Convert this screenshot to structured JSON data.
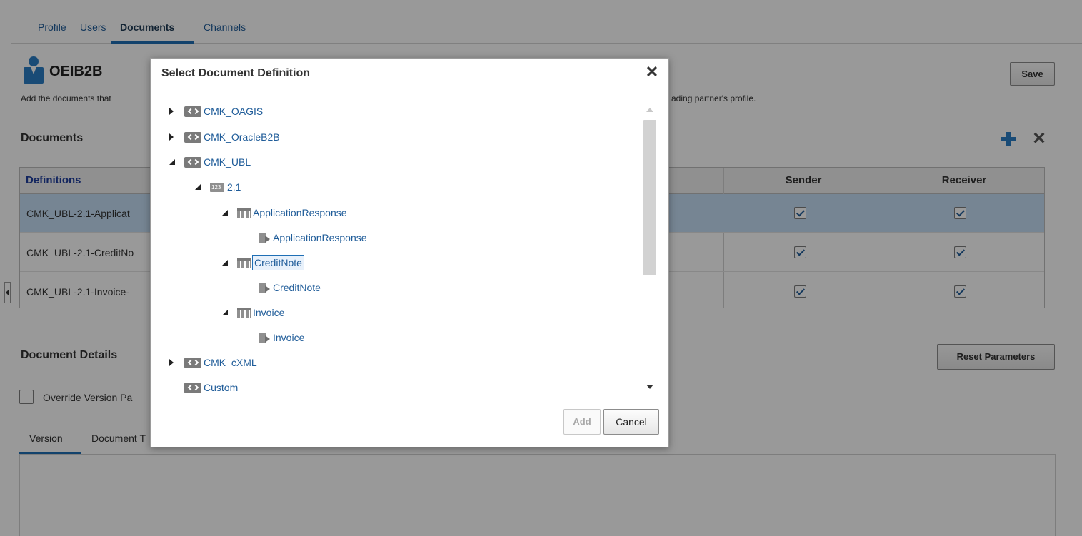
{
  "tabs": [
    {
      "label": "Profile"
    },
    {
      "label": "Users"
    },
    {
      "label": "Documents"
    },
    {
      "label": "Channels"
    }
  ],
  "active_tab": "Documents",
  "partner": {
    "name": "OEIB2B",
    "description_left": "Add the documents that",
    "description_right": "ading partner's profile."
  },
  "toolbar": {
    "save_label": "Save",
    "reset_label": "Reset Parameters"
  },
  "documents": {
    "heading": "Documents",
    "columns": {
      "definitions": "Definitions",
      "sender": "Sender",
      "receiver": "Receiver"
    },
    "rows": [
      {
        "name": "CMK_UBL-2.1-Applicat",
        "sender": true,
        "receiver": true,
        "selected": true
      },
      {
        "name": "CMK_UBL-2.1-CreditNo",
        "sender": true,
        "receiver": true,
        "selected": false
      },
      {
        "name": "CMK_UBL-2.1-Invoice-",
        "sender": true,
        "receiver": true,
        "selected": false
      }
    ]
  },
  "details": {
    "heading": "Document Details",
    "override_label": "Override Version Pa",
    "sub_tabs": [
      {
        "label": "Version"
      },
      {
        "label": "Document T"
      }
    ]
  },
  "dialog": {
    "title": "Select Document Definition",
    "close_glyph": "✕",
    "tree": [
      {
        "label": "CMK_OAGIS",
        "icon": "schema-icon",
        "state": "collapsed"
      },
      {
        "label": "CMK_OracleB2B",
        "icon": "schema-icon",
        "state": "collapsed"
      },
      {
        "label": "CMK_UBL",
        "icon": "schema-icon",
        "state": "expanded"
      },
      {
        "label": "2.1",
        "icon": "version-icon",
        "state": "expanded"
      },
      {
        "label": "ApplicationResponse",
        "icon": "document-type-icon",
        "state": "expanded"
      },
      {
        "label": "ApplicationResponse",
        "icon": "document-definition-icon",
        "state": "leaf"
      },
      {
        "label": "CreditNote",
        "icon": "document-type-icon",
        "state": "expanded",
        "selected": true
      },
      {
        "label": "CreditNote",
        "icon": "document-definition-icon",
        "state": "leaf"
      },
      {
        "label": "Invoice",
        "icon": "document-type-icon",
        "state": "expanded"
      },
      {
        "label": "Invoice",
        "icon": "document-definition-icon",
        "state": "leaf"
      },
      {
        "label": "CMK_cXML",
        "icon": "schema-icon",
        "state": "collapsed"
      },
      {
        "label": "Custom",
        "icon": "schema-icon",
        "state": "leaf"
      }
    ],
    "add_label": "Add",
    "cancel_label": "Cancel"
  },
  "colors": {
    "accent": "#1f6fb5",
    "link": "#1f5c99",
    "selected_row": "#c5def5"
  }
}
